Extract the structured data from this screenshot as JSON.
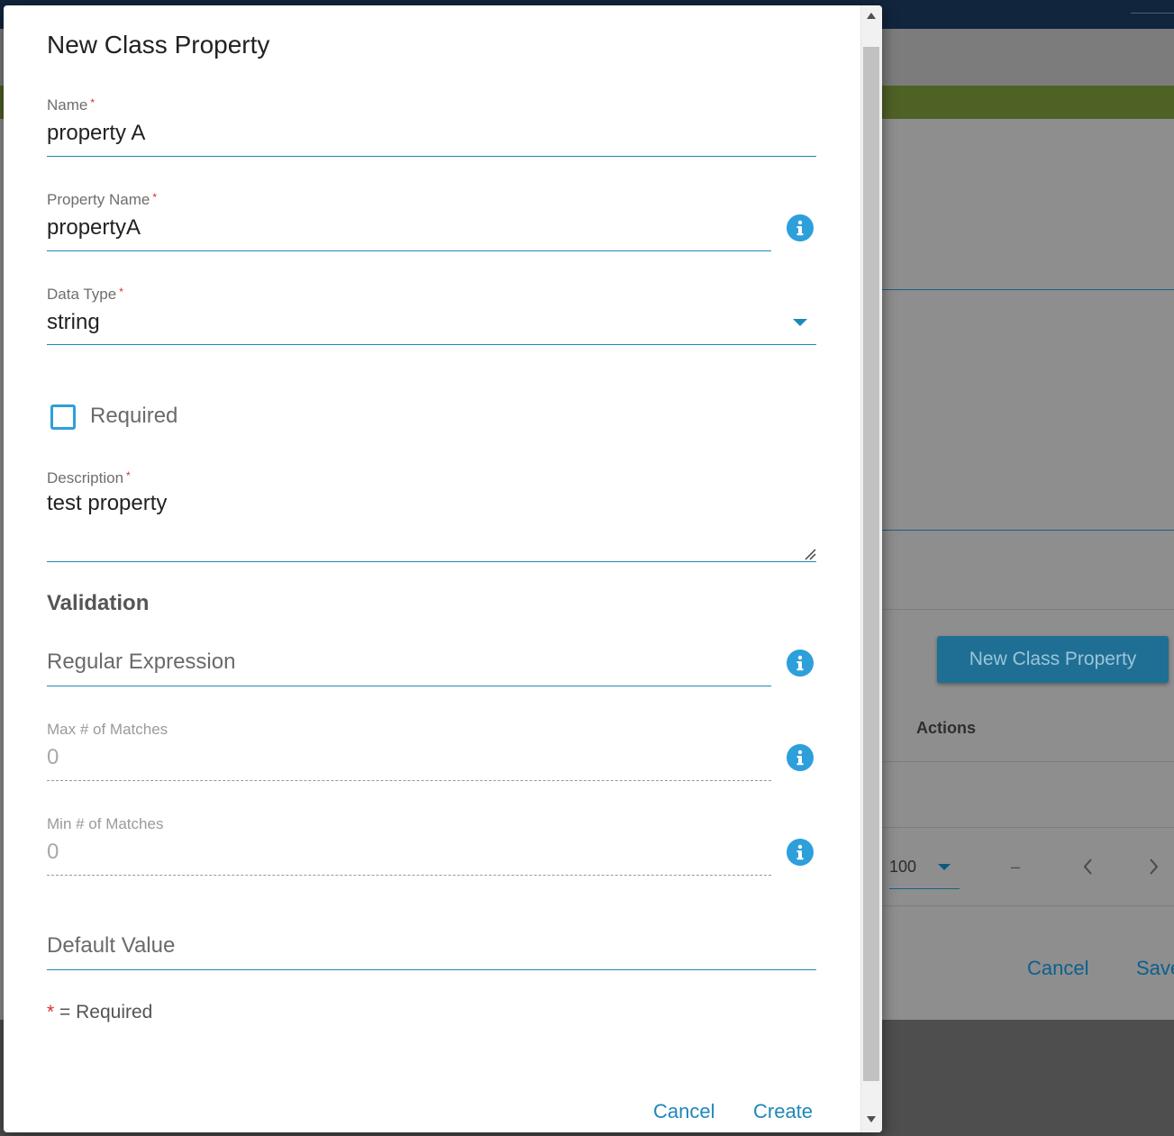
{
  "background": {
    "new_class_property_button": "New Class Property",
    "actions_header": "Actions",
    "page_size": "100",
    "range_dash": "–",
    "prev_icon": "chevron-left-icon",
    "next_icon": "chevron-right-icon",
    "cancel_label": "Cancel",
    "save_label": "Save"
  },
  "dialog": {
    "title": "New Class Property",
    "fields": {
      "name": {
        "label": "Name",
        "required_mark": "*",
        "value": "property A"
      },
      "property_name": {
        "label": "Property Name",
        "required_mark": "*",
        "value": "propertyA",
        "icon": "info-icon"
      },
      "data_type": {
        "label": "Data Type",
        "required_mark": "*",
        "value": "string",
        "icon": "chevron-down-icon"
      },
      "required": {
        "label": "Required",
        "checked": false
      },
      "description": {
        "label": "Description",
        "required_mark": "*",
        "value": "test property"
      }
    },
    "validation": {
      "title": "Validation",
      "regular_expression": {
        "placeholder": "Regular Expression",
        "icon": "info-icon"
      },
      "max_matches": {
        "label": "Max # of Matches",
        "value": "0",
        "icon": "info-icon"
      },
      "min_matches": {
        "label": "Min # of Matches",
        "value": "0",
        "icon": "info-icon"
      }
    },
    "default_value": {
      "placeholder": "Default Value"
    },
    "required_note": {
      "star": "*",
      "text": "= Required"
    },
    "buttons": {
      "cancel": "Cancel",
      "create": "Create"
    }
  },
  "colors": {
    "accent": "#2d9fdb",
    "required_mark": "#d32f2f",
    "topbar": "#11253d",
    "greenbar": "#4f6226"
  }
}
